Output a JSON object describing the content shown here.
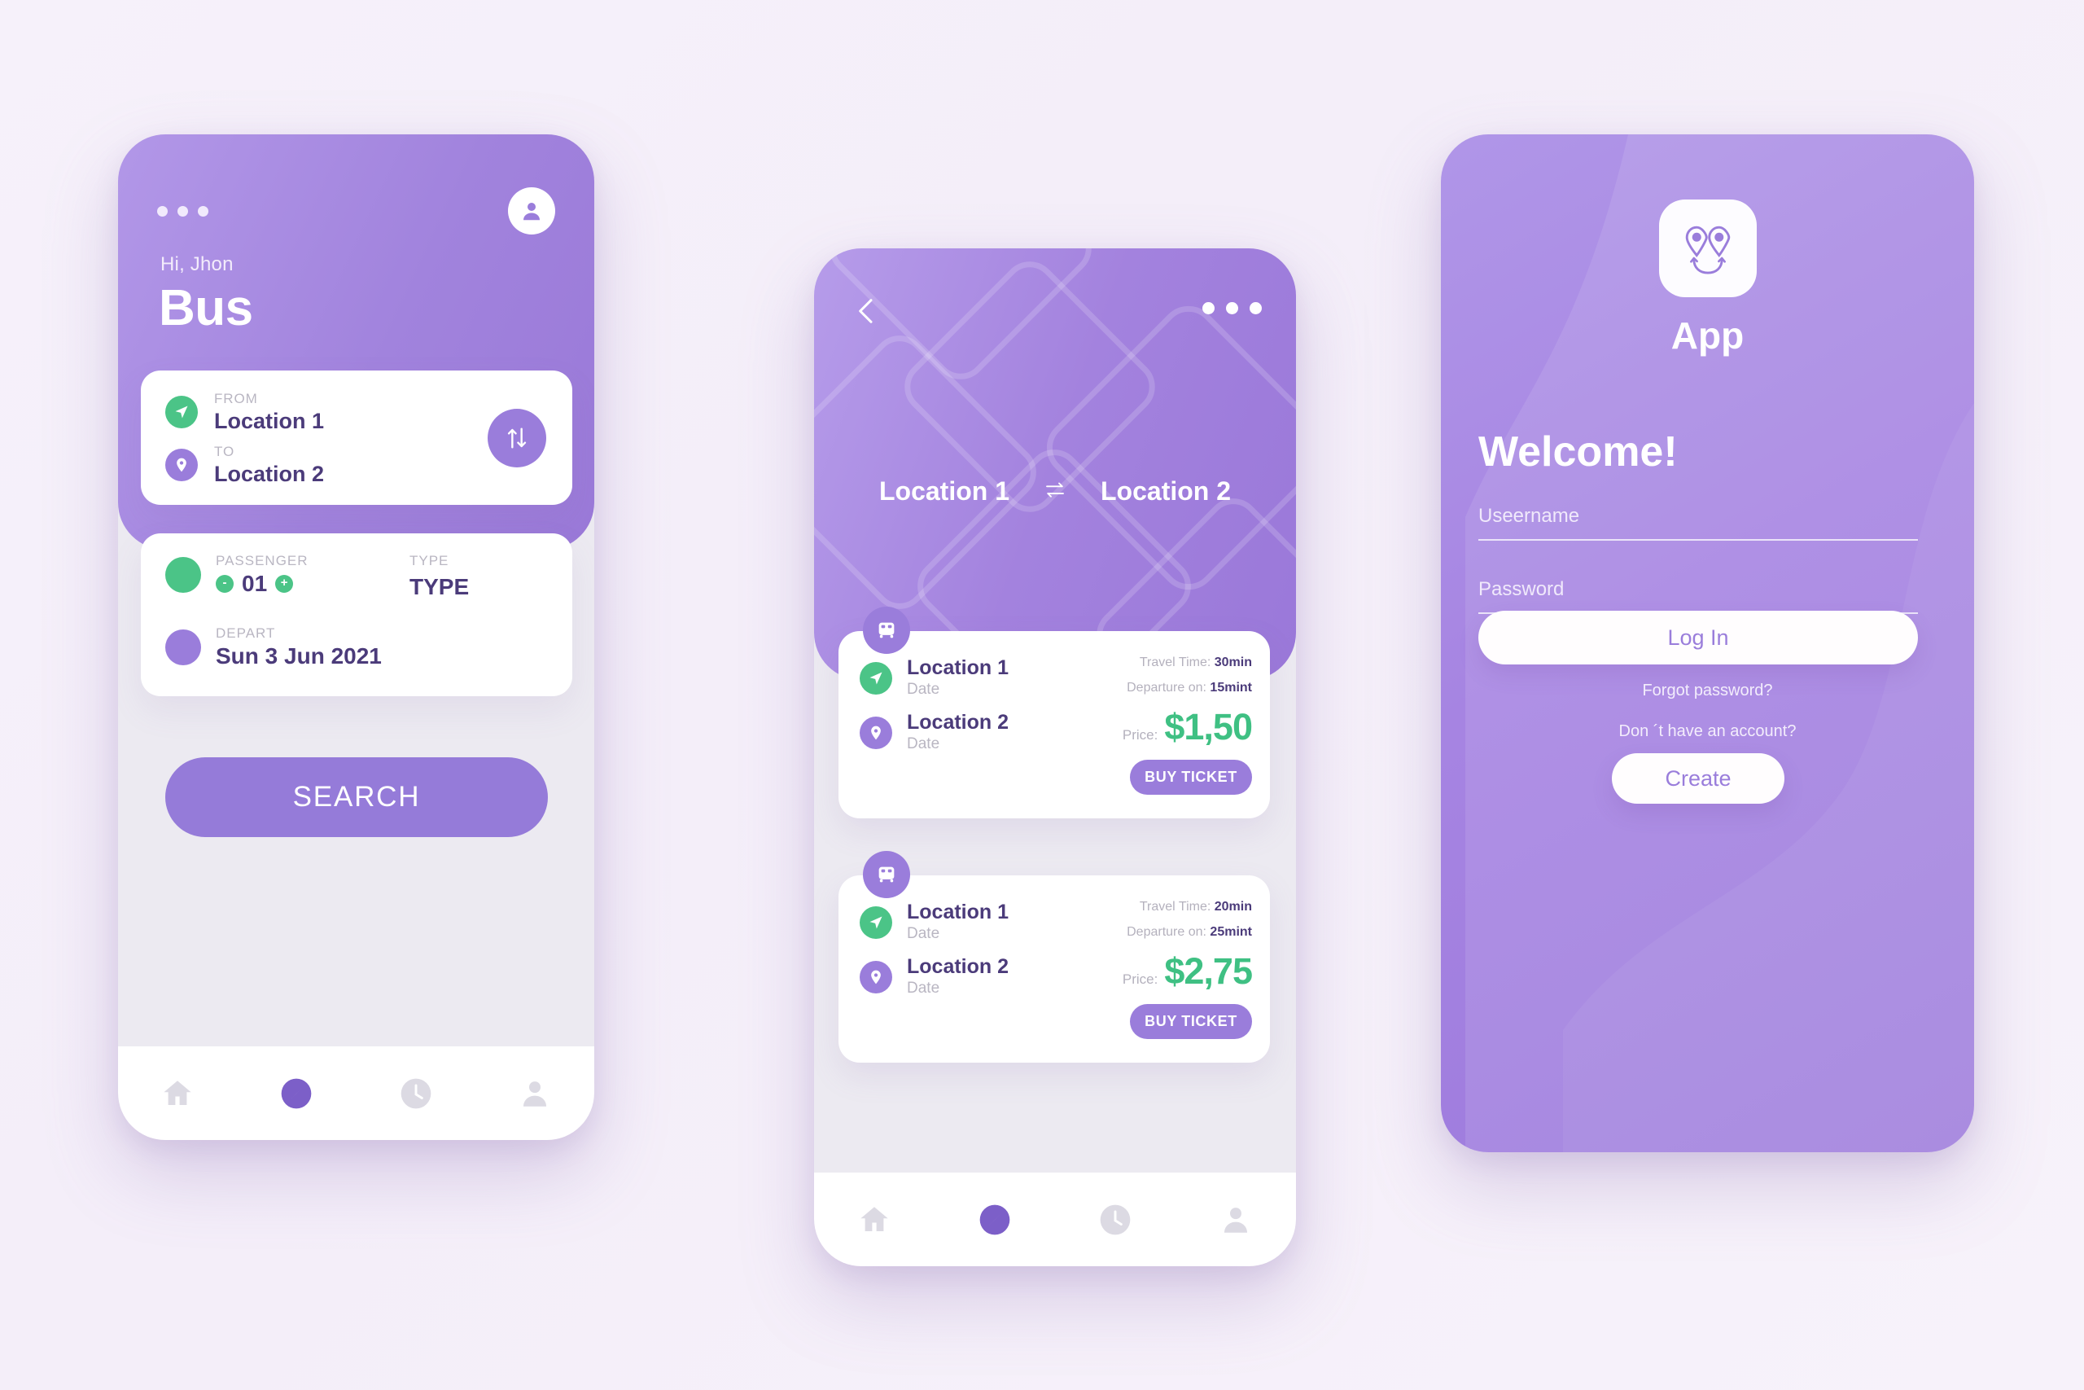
{
  "palette": {
    "purple": "#9a7ddb",
    "purple_dark": "#4b3b7a",
    "green": "#4bc487",
    "price_green": "#3fc083",
    "grey_text": "#b9b6c2",
    "page_bg": "#f6f1fa"
  },
  "phone1": {
    "menu_icon": "more-dots-icon",
    "avatar_icon": "user-avatar-icon",
    "greeting": "Hi, Jhon",
    "title": "Bus",
    "route_card": {
      "from_label": "FROM",
      "from_value": "Location 1",
      "from_icon": "navigation-arrow-icon",
      "to_label": "TO",
      "to_value": "Location 2",
      "to_icon": "map-pin-icon",
      "swap_icon": "swap-vertical-arrows-icon"
    },
    "options_card": {
      "passenger_label": "PASSENGER",
      "passenger_value": "01",
      "decrement": "-",
      "increment": "+",
      "type_label": "TYPE",
      "type_value": "TYPE",
      "depart_label": "DEPART",
      "depart_value": "Sun 3 Jun 2021"
    },
    "search_button": "SEARCH",
    "nav": [
      {
        "name": "home-icon",
        "active": false
      },
      {
        "name": "compass-icon",
        "active": true
      },
      {
        "name": "clock-icon",
        "active": false
      },
      {
        "name": "person-icon",
        "active": false
      }
    ]
  },
  "phone2": {
    "back_icon": "chevron-left-icon",
    "menu_icon": "more-dots-icon",
    "origin": "Location 1",
    "swap_icon": "swap-horizontal-arrows-icon",
    "destination": "Location 2",
    "tickets": [
      {
        "bus_icon": "bus-icon",
        "from_icon": "navigation-arrow-icon",
        "from_name": "Location 1",
        "from_date": "Date",
        "to_icon": "map-pin-icon",
        "to_name": "Location 2",
        "to_date": "Date",
        "travel_time_label": "Travel Time:",
        "travel_time_value": "30min",
        "departure_label": "Departure on:",
        "departure_value": "15mint",
        "price_label": "Price:",
        "price_value": "$1,50",
        "buy_label": "BUY TICKET"
      },
      {
        "bus_icon": "bus-icon",
        "from_icon": "navigation-arrow-icon",
        "from_name": "Location 1",
        "from_date": "Date",
        "to_icon": "map-pin-icon",
        "to_name": "Location 2",
        "to_date": "Date",
        "travel_time_label": "Travel Time:",
        "travel_time_value": "20min",
        "departure_label": "Departure on:",
        "departure_value": "25mint",
        "price_label": "Price:",
        "price_value": "$2,75",
        "buy_label": "BUY TICKET"
      }
    ],
    "nav": [
      {
        "name": "home-icon",
        "active": false
      },
      {
        "name": "compass-icon",
        "active": true
      },
      {
        "name": "clock-icon",
        "active": false
      },
      {
        "name": "person-icon",
        "active": false
      }
    ]
  },
  "phone3": {
    "logo_icon": "smiley-map-pins-logo-icon",
    "app_name": "App",
    "welcome": "Welcome!",
    "username_placeholder": "Useername",
    "password_placeholder": "Password",
    "login_button": "Log In",
    "forgot_password": "Forgot password?",
    "no_account": "Don ´t have an account?",
    "create_button": "Create"
  }
}
